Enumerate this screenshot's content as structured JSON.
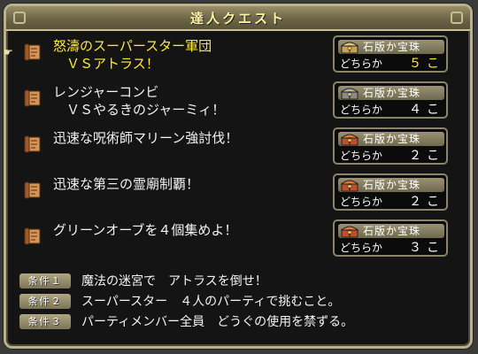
{
  "window": {
    "title": "達人クエスト"
  },
  "quests": [
    {
      "title": "怒濤のスーパースター軍団\n　ＶＳアトラス！",
      "selected": true,
      "reward_label": "石版か宝珠",
      "choice_label": "どちらか",
      "count": "５",
      "unit": "こ",
      "chest_color": "gold"
    },
    {
      "title": "レンジャーコンビ\n　ＶＳやるきのジャーミィ！",
      "selected": false,
      "reward_label": "石版か宝珠",
      "choice_label": "どちらか",
      "count": "４",
      "unit": "こ",
      "chest_color": "silver"
    },
    {
      "title": "迅速な呪術師マリーン強討伐！",
      "selected": false,
      "reward_label": "石版か宝珠",
      "choice_label": "どちらか",
      "count": "２",
      "unit": "こ",
      "chest_color": "red"
    },
    {
      "title": "迅速な第三の霊廟制覇！",
      "selected": false,
      "reward_label": "石版か宝珠",
      "choice_label": "どちらか",
      "count": "２",
      "unit": "こ",
      "chest_color": "red"
    },
    {
      "title": "グリーンオーブを４個集めよ！",
      "selected": false,
      "reward_label": "石版か宝珠",
      "choice_label": "どちらか",
      "count": "３",
      "unit": "こ",
      "chest_color": "red"
    }
  ],
  "conditions": [
    {
      "badge": "条件１",
      "text": "魔法の迷宮で　アトラスを倒せ！"
    },
    {
      "badge": "条件２",
      "text": "スーパースター　４人のパーティで挑むこと。"
    },
    {
      "badge": "条件３",
      "text": "パーティメンバー全員　どうぐの使用を禁ずる。"
    }
  ],
  "colors": {
    "highlight": "#ffe93a",
    "frame": "#b9b08e",
    "text": "#f2f2f2"
  },
  "icons": {
    "cursor": "pointing-hand-icon",
    "quest": "scroll-icon",
    "reward": "treasure-chest-icon"
  }
}
